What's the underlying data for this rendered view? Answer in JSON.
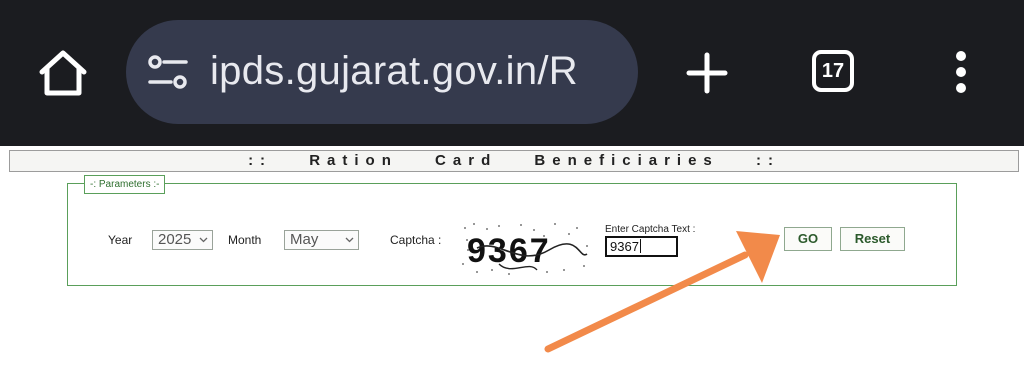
{
  "browser": {
    "url": "ipds.gujarat.gov.in/R",
    "tab_count": "17"
  },
  "page": {
    "header": ":: Ration Card Beneficiaries ::",
    "fieldset_legend": "-: Parameters :-",
    "year_label": "Year",
    "year_value": "2025",
    "month_label": "Month",
    "month_value": "May",
    "captcha_label": "Captcha :",
    "captcha_image_text": "9367",
    "captcha_input_label": "Enter Captcha Text :",
    "captcha_input_value": "9367",
    "go_button": "GO",
    "reset_button": "Reset"
  },
  "colors": {
    "chrome_bg": "#1b1c20",
    "url_bg": "#353a4d",
    "border_green": "#5a9f5a",
    "arrow_orange": "#f28a4a"
  }
}
